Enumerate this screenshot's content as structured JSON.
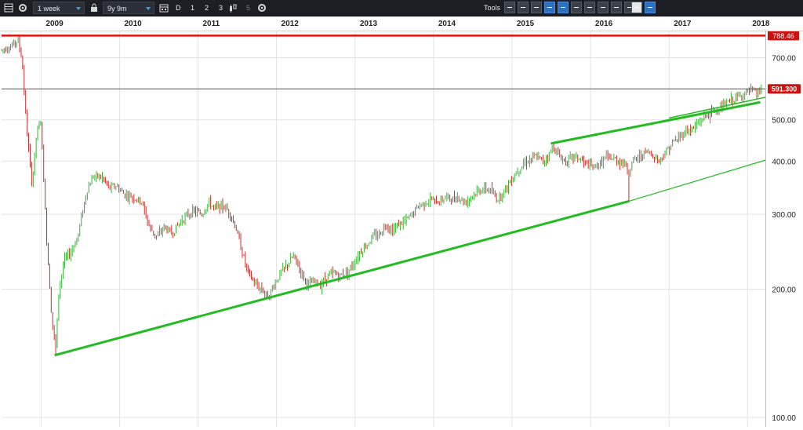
{
  "toolbar": {
    "interval": "1 week",
    "range": "9y 9m",
    "frequency_letter": "D",
    "period_1": "1",
    "period_2": "2",
    "period_3": "3",
    "period_5": "5",
    "tools_label": "Tools",
    "icons": [
      "table-icon",
      "gear-icon",
      "lock-icon",
      "calendar-icon",
      "candlestick-icon",
      "settings-icon",
      "arrow-icon",
      "trend-line-icon",
      "text-icon",
      "grid-icon",
      "fibonacci-icon",
      "candle-icon",
      "layers-icon",
      "line-icon",
      "shape-icon",
      "label-icon",
      "print-icon",
      "share-icon"
    ]
  },
  "colors": {
    "up": "#33b233",
    "down": "#cc2a2a",
    "resistance": "#e01010",
    "trend": "#22bb22",
    "price_tag": "#cc1111",
    "grid": "#e3e3e3"
  },
  "chart_data": {
    "type": "candlestick",
    "y_scale": "log",
    "ylim": [
      95,
      800
    ],
    "x_range": [
      "2008-07-01",
      "2018-03-25"
    ],
    "y_ticks": [
      {
        "value": 700,
        "label": "700.00"
      },
      {
        "value": 500,
        "label": "500.00"
      },
      {
        "value": 400,
        "label": "400.00"
      },
      {
        "value": 300,
        "label": "300.00"
      },
      {
        "value": 200,
        "label": "200.00"
      },
      {
        "value": 100,
        "label": "100.00"
      }
    ],
    "years": [
      {
        "date": "2009-01-01",
        "label": "2009"
      },
      {
        "date": "2010-01-01",
        "label": "2010"
      },
      {
        "date": "2011-01-01",
        "label": "2011"
      },
      {
        "date": "2012-01-01",
        "label": "2012"
      },
      {
        "date": "2013-01-01",
        "label": "2013"
      },
      {
        "date": "2014-01-01",
        "label": "2014"
      },
      {
        "date": "2015-01-01",
        "label": "2015"
      },
      {
        "date": "2016-01-01",
        "label": "2016"
      },
      {
        "date": "2017-01-01",
        "label": "2017"
      },
      {
        "date": "2018-01-01",
        "label": "2018"
      }
    ],
    "price_path": [
      [
        "2008-07-01",
        730
      ],
      [
        "2008-08-15",
        745
      ],
      [
        "2008-09-15",
        770
      ],
      [
        "2008-10-05",
        690
      ],
      [
        "2008-10-25",
        480
      ],
      [
        "2008-11-20",
        350
      ],
      [
        "2008-12-10",
        460
      ],
      [
        "2008-12-31",
        500
      ],
      [
        "2009-01-25",
        270
      ],
      [
        "2009-02-20",
        170
      ],
      [
        "2009-03-10",
        145
      ],
      [
        "2009-03-25",
        200
      ],
      [
        "2009-04-20",
        235
      ],
      [
        "2009-05-20",
        245
      ],
      [
        "2009-06-20",
        265
      ],
      [
        "2009-07-10",
        300
      ],
      [
        "2009-08-01",
        340
      ],
      [
        "2009-09-01",
        370
      ],
      [
        "2009-10-15",
        365
      ],
      [
        "2009-11-15",
        345
      ],
      [
        "2009-12-15",
        350
      ],
      [
        "2010-01-20",
        335
      ],
      [
        "2010-03-01",
        330
      ],
      [
        "2010-04-15",
        320
      ],
      [
        "2010-05-20",
        280
      ],
      [
        "2010-06-25",
        265
      ],
      [
        "2010-07-25",
        280
      ],
      [
        "2010-09-01",
        270
      ],
      [
        "2010-10-15",
        290
      ],
      [
        "2010-11-15",
        300
      ],
      [
        "2010-12-15",
        305
      ],
      [
        "2011-01-20",
        300
      ],
      [
        "2011-02-20",
        320
      ],
      [
        "2011-03-20",
        310
      ],
      [
        "2011-04-20",
        315
      ],
      [
        "2011-05-25",
        305
      ],
      [
        "2011-06-25",
        280
      ],
      [
        "2011-07-25",
        245
      ],
      [
        "2011-08-20",
        220
      ],
      [
        "2011-09-25",
        205
      ],
      [
        "2011-10-25",
        200
      ],
      [
        "2011-11-25",
        192
      ],
      [
        "2011-12-20",
        205
      ],
      [
        "2012-01-25",
        220
      ],
      [
        "2012-02-25",
        230
      ],
      [
        "2012-03-20",
        240
      ],
      [
        "2012-04-25",
        220
      ],
      [
        "2012-05-25",
        205
      ],
      [
        "2012-06-25",
        208
      ],
      [
        "2012-07-25",
        205
      ],
      [
        "2012-08-25",
        215
      ],
      [
        "2012-09-25",
        218
      ],
      [
        "2012-10-25",
        215
      ],
      [
        "2012-11-25",
        220
      ],
      [
        "2012-12-25",
        230
      ],
      [
        "2013-01-25",
        245
      ],
      [
        "2013-02-25",
        255
      ],
      [
        "2013-03-25",
        265
      ],
      [
        "2013-04-25",
        270
      ],
      [
        "2013-05-25",
        285
      ],
      [
        "2013-06-25",
        275
      ],
      [
        "2013-07-25",
        285
      ],
      [
        "2013-08-25",
        290
      ],
      [
        "2013-09-25",
        300
      ],
      [
        "2013-10-25",
        315
      ],
      [
        "2013-11-25",
        320
      ],
      [
        "2013-12-25",
        325
      ],
      [
        "2014-01-25",
        320
      ],
      [
        "2014-02-25",
        330
      ],
      [
        "2014-03-25",
        325
      ],
      [
        "2014-04-25",
        330
      ],
      [
        "2014-05-25",
        320
      ],
      [
        "2014-06-25",
        330
      ],
      [
        "2014-07-25",
        340
      ],
      [
        "2014-08-25",
        345
      ],
      [
        "2014-09-25",
        340
      ],
      [
        "2014-10-25",
        325
      ],
      [
        "2014-11-25",
        340
      ],
      [
        "2014-12-25",
        360
      ],
      [
        "2015-01-25",
        380
      ],
      [
        "2015-02-25",
        395
      ],
      [
        "2015-03-25",
        405
      ],
      [
        "2015-04-25",
        410
      ],
      [
        "2015-05-25",
        400
      ],
      [
        "2015-06-25",
        415
      ],
      [
        "2015-07-10",
        435
      ],
      [
        "2015-08-10",
        410
      ],
      [
        "2015-09-10",
        400
      ],
      [
        "2015-10-10",
        410
      ],
      [
        "2015-11-10",
        405
      ],
      [
        "2015-12-10",
        395
      ],
      [
        "2016-01-15",
        385
      ],
      [
        "2016-02-15",
        395
      ],
      [
        "2016-03-15",
        410
      ],
      [
        "2016-04-15",
        405
      ],
      [
        "2016-05-15",
        400
      ],
      [
        "2016-06-15",
        390
      ],
      [
        "2016-06-28",
        375
      ],
      [
        "2016-07-15",
        400
      ],
      [
        "2016-08-15",
        410
      ],
      [
        "2016-09-15",
        420
      ],
      [
        "2016-10-15",
        415
      ],
      [
        "2016-11-15",
        400
      ],
      [
        "2016-12-15",
        420
      ],
      [
        "2017-01-15",
        440
      ],
      [
        "2017-02-15",
        455
      ],
      [
        "2017-03-15",
        470
      ],
      [
        "2017-04-15",
        475
      ],
      [
        "2017-05-15",
        490
      ],
      [
        "2017-06-15",
        510
      ],
      [
        "2017-07-15",
        520
      ],
      [
        "2017-08-15",
        530
      ],
      [
        "2017-09-15",
        540
      ],
      [
        "2017-10-15",
        555
      ],
      [
        "2017-11-15",
        565
      ],
      [
        "2017-12-15",
        575
      ],
      [
        "2018-01-15",
        585
      ],
      [
        "2018-02-15",
        575
      ],
      [
        "2018-03-10",
        591.3
      ]
    ],
    "spikes": [
      {
        "date": "2016-06-28",
        "low": 320
      },
      {
        "date": "2009-03-10",
        "low": 140
      }
    ],
    "annotations": {
      "resistance": {
        "value": 788.46,
        "label": "788.46"
      },
      "last_price": {
        "value": 591.3,
        "label": "591.300"
      },
      "support_line": {
        "from": [
          "2009-03-05",
          140
        ],
        "to": [
          "2016-06-28",
          322
        ]
      },
      "support_extension": {
        "from": [
          "2016-06-28",
          322
        ],
        "to": [
          "2018-03-25",
          402
        ]
      },
      "upper_trend_line": {
        "from": [
          "2015-07-01",
          440
        ],
        "to": [
          "2018-03-01",
          550
        ]
      },
      "lower_wedge_line": {
        "from": [
          "2017-01-01",
          505
        ],
        "to": [
          "2018-03-25",
          565
        ]
      }
    }
  }
}
